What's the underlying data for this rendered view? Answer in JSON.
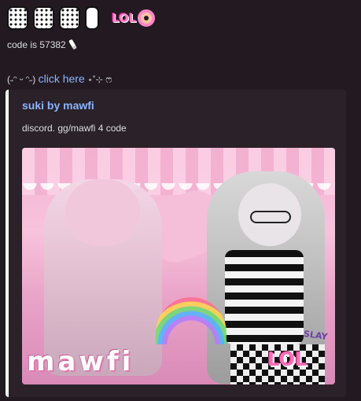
{
  "title": {
    "letters": [
      "S",
      "u",
      "k",
      "i"
    ],
    "lol_emote_text": "LOL",
    "lol_emote_icon": "donut-icon"
  },
  "lines": {
    "code_text": "code is 57382",
    "code_icon": "knife-icon",
    "kaomoji": "(˶ᵔ ᵕ ᵔ˶)",
    "click_link": "click here",
    "sparkle": "⋆˚⊹",
    "bow": "ෆ"
  },
  "embed": {
    "title": "suki by mawfi",
    "description": "discord. gg/mawfi 4 code",
    "accent_color": "#ffffff",
    "image": {
      "overlay_word": "mawfi",
      "overlay_lol": "LOL",
      "overlay_small": "SLAY"
    }
  },
  "colors": {
    "background": "#231a21",
    "embed_background": "#2b2128",
    "link": "#8ab4ff",
    "text": "#dbdee1"
  }
}
